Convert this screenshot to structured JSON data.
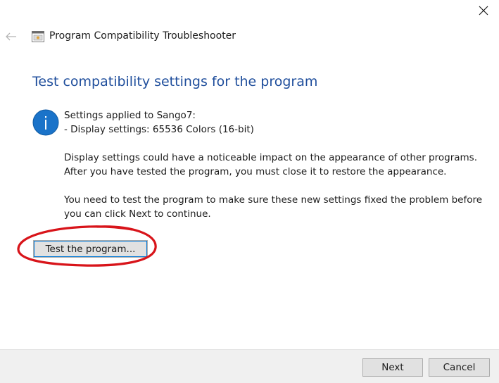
{
  "window": {
    "title": "Program Compatibility Troubleshooter"
  },
  "icons": {
    "close": "close-icon",
    "back": "back-arrow-icon",
    "app": "troubleshooter-app-icon",
    "info": "info-icon"
  },
  "main": {
    "heading": "Test compatibility settings for the program",
    "settings_applied": "Settings applied to Sango7:",
    "display_settings": "- Display settings:  65536 Colors (16-bit)",
    "impact_line1": "Display settings could have a noticeable impact on the appearance of other programs.",
    "impact_line2": "After you have tested the program, you must close it to restore the appearance.",
    "test_line1": "You need to test the program to make sure these new settings fixed the problem before",
    "test_line2": "you can click Next to continue.",
    "test_button": "Test the program..."
  },
  "footer": {
    "next_label": "Next",
    "cancel_label": "Cancel"
  },
  "colors": {
    "heading": "#1f4e9c",
    "info_icon": "#1a73c9",
    "annotation": "#d8141a",
    "footer_bg": "#f0f0f0"
  }
}
